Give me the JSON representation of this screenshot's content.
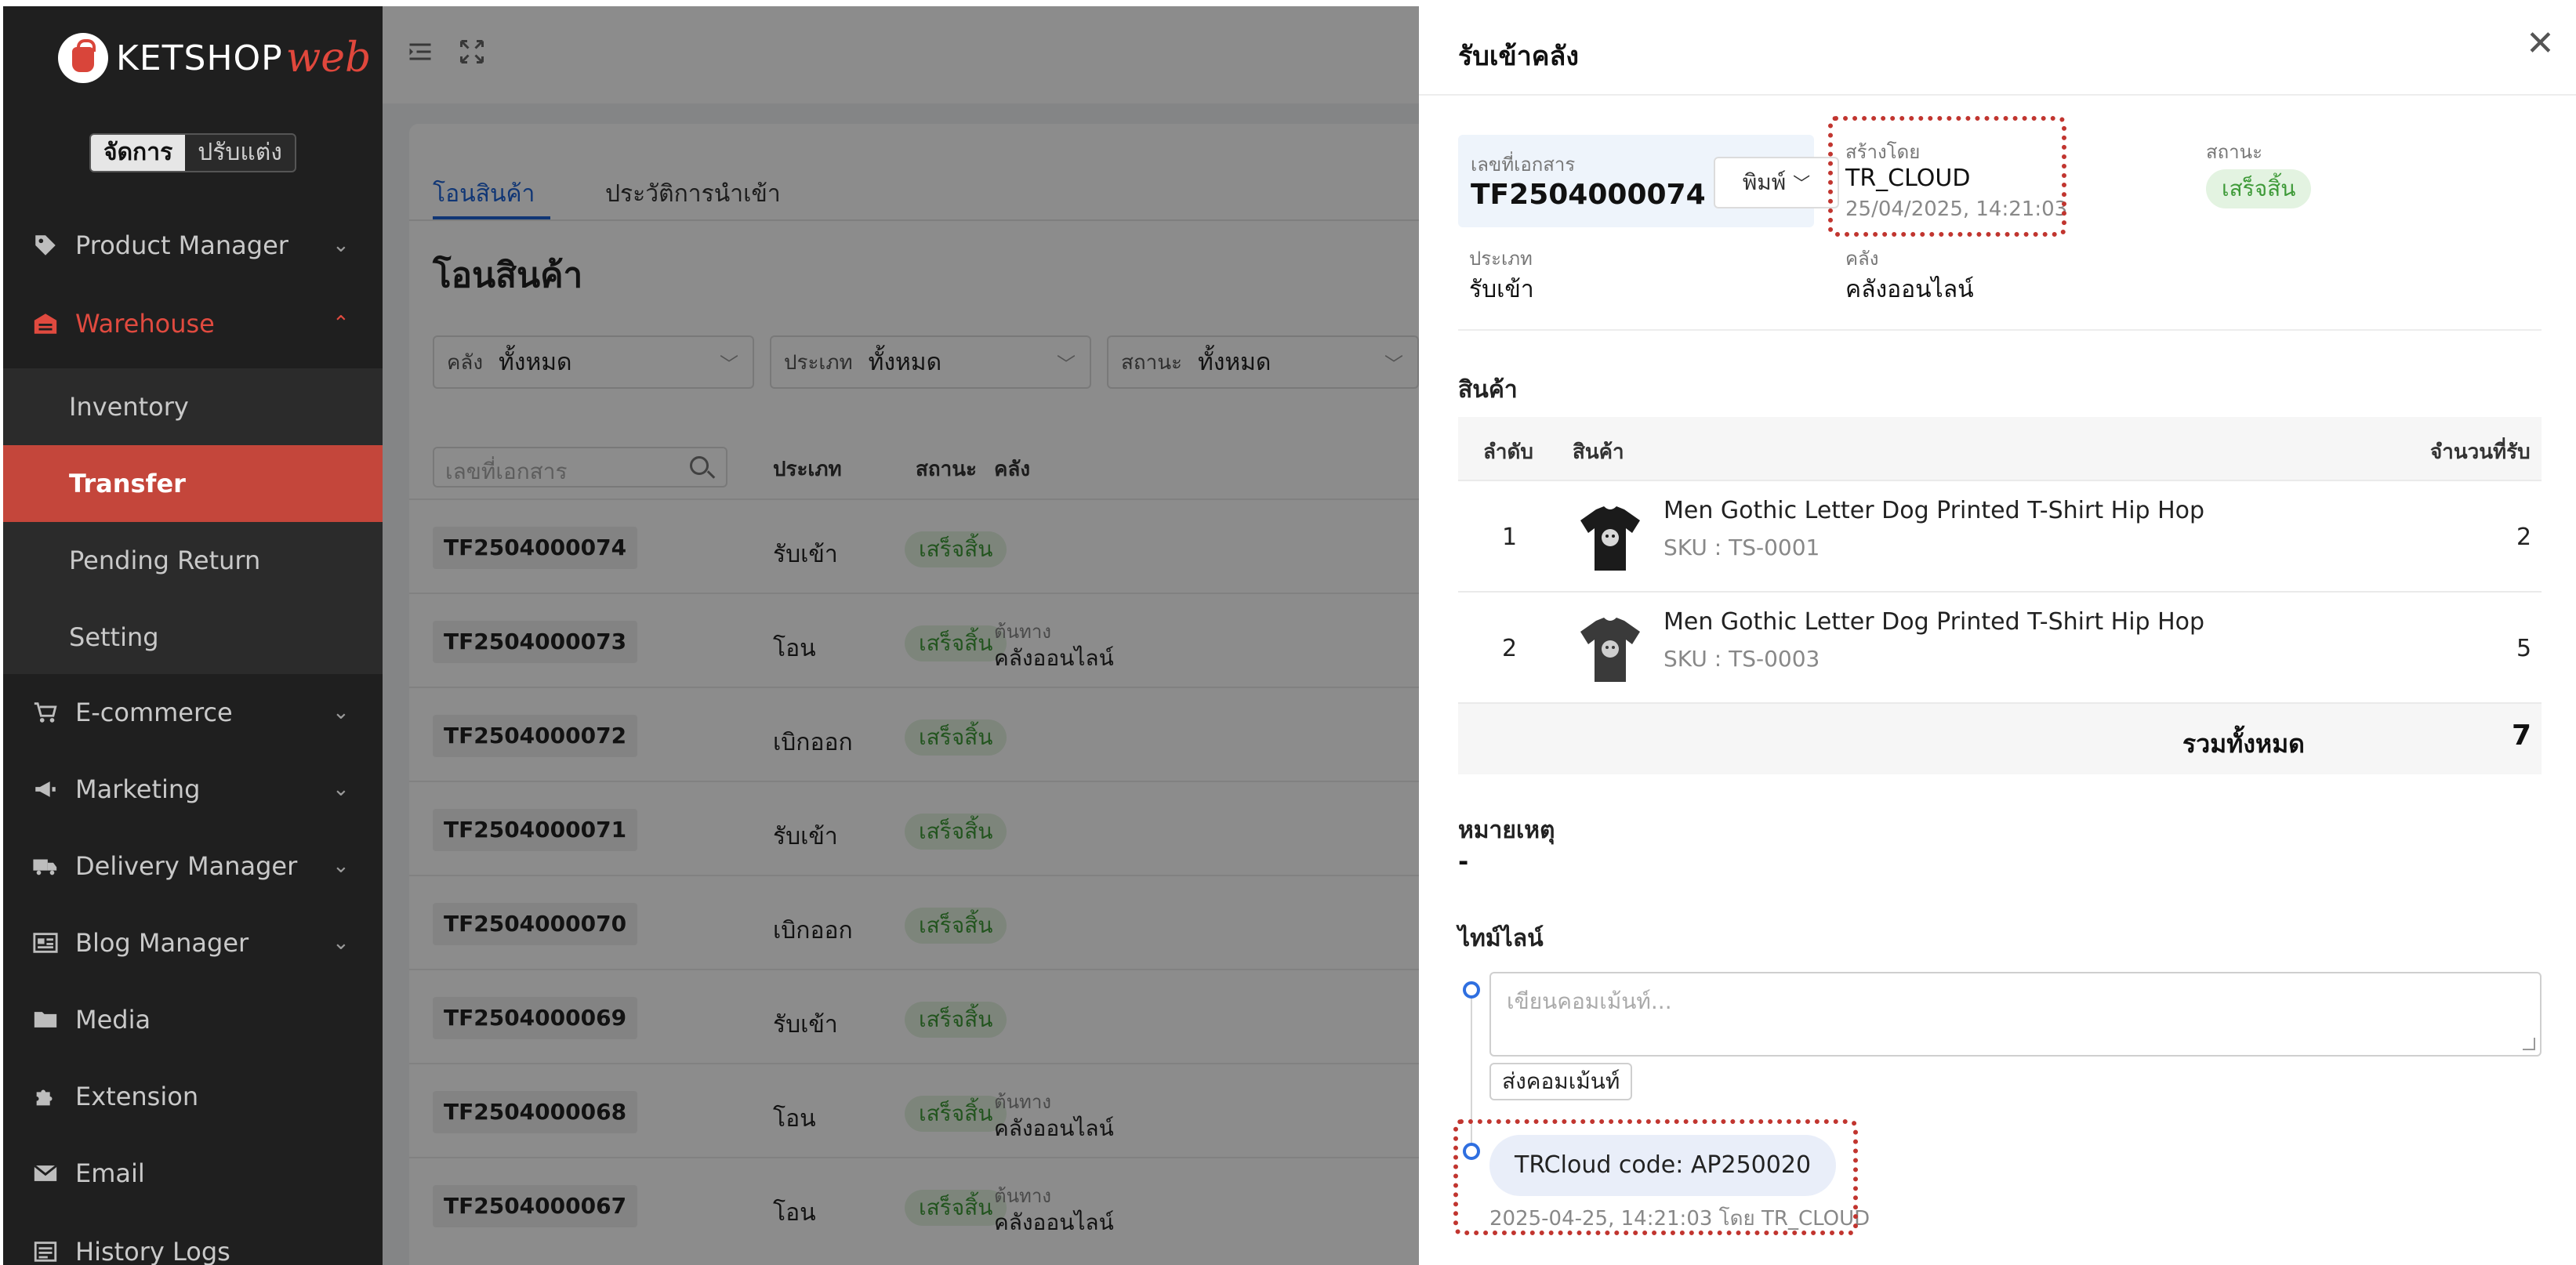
{
  "brand": {
    "name": "KETSHOP",
    "suffix": "web"
  },
  "mode_toggle": {
    "manage": "จัดการ",
    "customize": "ปรับแต่ง"
  },
  "sidebar": {
    "items": [
      {
        "label": "Product Manager",
        "icon": "tag-icon"
      },
      {
        "label": "Warehouse",
        "icon": "warehouse-icon"
      },
      {
        "label": "E-commerce",
        "icon": "cart-icon"
      },
      {
        "label": "Marketing",
        "icon": "megaphone-icon"
      },
      {
        "label": "Delivery Manager",
        "icon": "truck-icon"
      },
      {
        "label": "Blog Manager",
        "icon": "newspaper-icon"
      },
      {
        "label": "Media",
        "icon": "folder-icon"
      },
      {
        "label": "Extension",
        "icon": "puzzle-icon"
      },
      {
        "label": "Email",
        "icon": "envelope-icon"
      },
      {
        "label": "History Logs",
        "icon": "list-icon"
      }
    ],
    "warehouse_sub": [
      "Inventory",
      "Transfer",
      "Pending Return",
      "Setting"
    ]
  },
  "main": {
    "tabs": [
      "โอนสินค้า",
      "ประวัติการนำเข้า"
    ],
    "title": "โอนสินค้า",
    "filters": [
      {
        "label": "คลัง",
        "value": "ทั้งหมด"
      },
      {
        "label": "ประเภท",
        "value": "ทั้งหมด"
      },
      {
        "label": "สถานะ",
        "value": "ทั้งหมด"
      }
    ],
    "search_placeholder": "เลขที่เอกสาร",
    "columns": {
      "type": "ประเภท",
      "status": "สถานะ",
      "warehouse": "คลัง"
    },
    "rows": [
      {
        "doc": "TF2504000074",
        "type": "รับเข้า",
        "status": "เสร็จสิ้น",
        "wh_label": "",
        "wh_value": ""
      },
      {
        "doc": "TF2504000073",
        "type": "โอน",
        "status": "เสร็จสิ้น",
        "wh_label": "ต้นทาง",
        "wh_value": "คลังออนไลน์"
      },
      {
        "doc": "TF2504000072",
        "type": "เบิกออก",
        "status": "เสร็จสิ้น",
        "wh_label": "",
        "wh_value": ""
      },
      {
        "doc": "TF2504000071",
        "type": "รับเข้า",
        "status": "เสร็จสิ้น",
        "wh_label": "",
        "wh_value": ""
      },
      {
        "doc": "TF2504000070",
        "type": "เบิกออก",
        "status": "เสร็จสิ้น",
        "wh_label": "",
        "wh_value": ""
      },
      {
        "doc": "TF2504000069",
        "type": "รับเข้า",
        "status": "เสร็จสิ้น",
        "wh_label": "",
        "wh_value": ""
      },
      {
        "doc": "TF2504000068",
        "type": "โอน",
        "status": "เสร็จสิ้น",
        "wh_label": "ต้นทาง",
        "wh_value": "คลังออนไลน์"
      },
      {
        "doc": "TF2504000067",
        "type": "โอน",
        "status": "เสร็จสิ้น",
        "wh_label": "ต้นทาง",
        "wh_value": "คลังออนไลน์"
      }
    ]
  },
  "drawer": {
    "title": "รับเข้าคลัง",
    "doc_label": "เลขที่เอกสาร",
    "doc_number": "TF2504000074",
    "print_label": "พิมพ์",
    "created_by_label": "สร้างโดย",
    "created_by": "TR_CLOUD",
    "created_at": "25/04/2025, 14:21:03",
    "status_label": "สถานะ",
    "status": "เสร็จสิ้น",
    "type_label": "ประเภท",
    "type": "รับเข้า",
    "warehouse_label": "คลัง",
    "warehouse": "คลังออนไลน์",
    "products_heading": "สินค้า",
    "product_columns": {
      "index": "ลำดับ",
      "product": "สินค้า",
      "qty": "จำนวนที่รับ"
    },
    "products": [
      {
        "index": "1",
        "name": "Men Gothic Letter Dog Printed T-Shirt Hip Hop",
        "sku": "SKU : TS-0001",
        "qty": "2"
      },
      {
        "index": "2",
        "name": "Men Gothic Letter Dog Printed T-Shirt Hip Hop",
        "sku": "SKU : TS-0003",
        "qty": "5"
      }
    ],
    "total_label": "รวมทั้งหมด",
    "total_value": "7",
    "note_heading": "หมายเหตุ",
    "note_value": "-",
    "timeline_heading": "ไทม์ไลน์",
    "comment_placeholder": "เขียนคอมเม้นท์...",
    "send_comment": "ส่งคอมเม้นท์",
    "timeline_entry": "TRCloud code: AP250020",
    "timeline_meta": "2025-04-25, 14:21:03 โดย TR_CLOUD"
  },
  "colors": {
    "sidebar_bg": "#1f1f1f",
    "accent_red": "#c4463b",
    "link_blue": "#1e63d6",
    "status_green": "#3e9a38",
    "highlight_dotted": "#c1352f"
  }
}
